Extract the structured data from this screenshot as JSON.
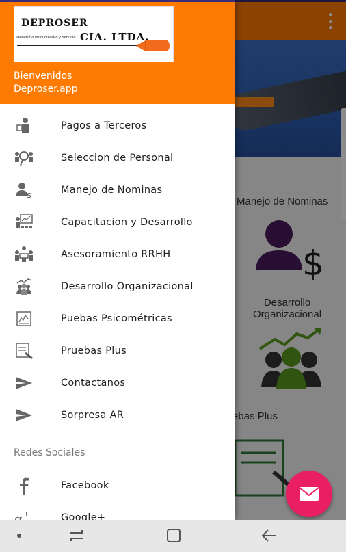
{
  "drawer": {
    "logo": {
      "title": "DEPROSER",
      "subtitle": "Desarrollo Productividad y Servicio",
      "company": "CIA. LTDA."
    },
    "welcome": "Bienvenidos",
    "site": "Deproser.app",
    "menu": [
      {
        "label": "Pagos a Terceros",
        "icon": "person-pay-icon"
      },
      {
        "label": "Seleccion de Personal",
        "icon": "people-search-icon"
      },
      {
        "label": "Manejo de Nominas",
        "icon": "person-dollar-icon"
      },
      {
        "label": "Capacitacion y Desarrollo",
        "icon": "presentation-icon"
      },
      {
        "label": "Asesoramiento RRHH",
        "icon": "meeting-icon"
      },
      {
        "label": "Desarrollo Organizacional",
        "icon": "growth-team-icon"
      },
      {
        "label": "Puebas Psicométricas",
        "icon": "chart-board-icon"
      },
      {
        "label": "Pruebas Plus",
        "icon": "document-pen-icon"
      },
      {
        "label": "Contactanos",
        "icon": "send-icon"
      },
      {
        "label": "Sorpresa AR",
        "icon": "send-icon"
      }
    ],
    "social_header": "Redes Sociales",
    "social": [
      {
        "label": "Facebook",
        "icon": "facebook-icon"
      },
      {
        "label": "Google+",
        "icon": "google-plus-icon"
      }
    ]
  },
  "background": {
    "card1": "Manejo de Nominas",
    "card2_line1": "Desarrollo",
    "card2_line2": "Organizacional",
    "card3": "ebas Plus"
  },
  "colors": {
    "accent": "#ff7a00",
    "fab": "#e91e63",
    "purple": "#4a1a5e"
  }
}
